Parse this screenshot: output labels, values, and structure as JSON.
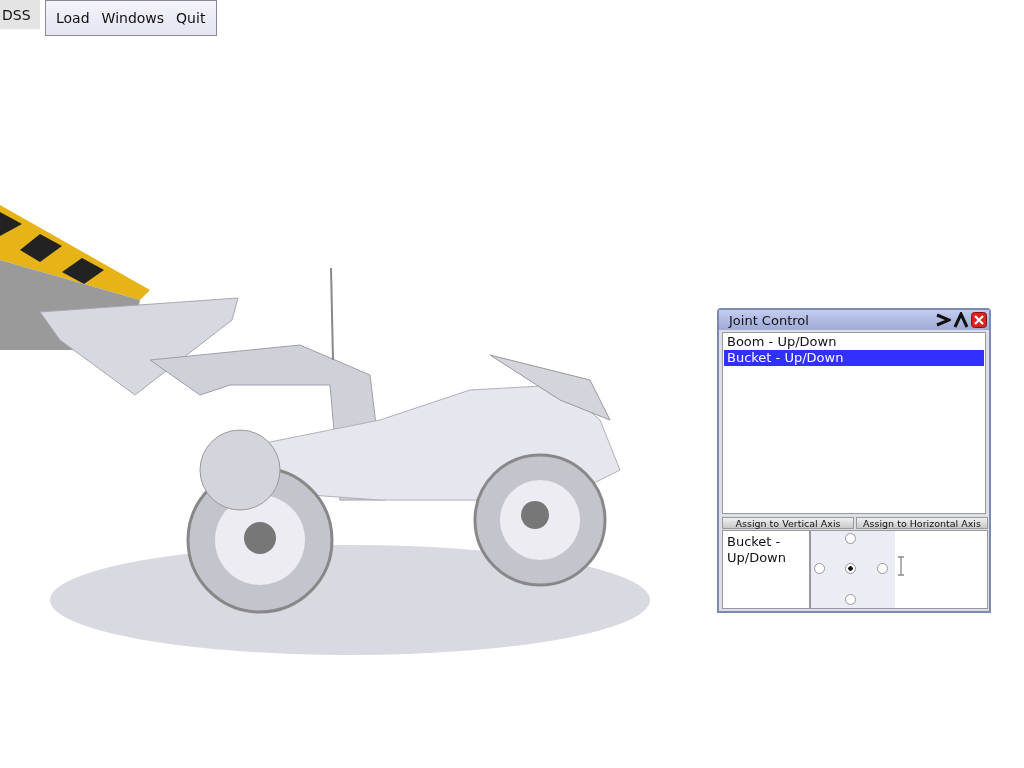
{
  "top_bar": {
    "app_label": "DSS",
    "menu": [
      {
        "label": "Load"
      },
      {
        "label": "Windows"
      },
      {
        "label": "Quit"
      }
    ]
  },
  "joint_control": {
    "title": "Joint Control",
    "joints": [
      {
        "label": "Boom - Up/Down",
        "selected": false
      },
      {
        "label": "Bucket - Up/Down",
        "selected": true
      }
    ],
    "buttons": [
      "Assign to Vertical Axis",
      "Assign to Horizontal Axis"
    ],
    "assigned_joint": "Bucket - Up/Down",
    "pad_positions": [
      {
        "kind": "up",
        "selected": false
      },
      {
        "kind": "left",
        "selected": false
      },
      {
        "kind": "center",
        "selected": true
      },
      {
        "kind": "right",
        "selected": false
      },
      {
        "kind": "down",
        "selected": false
      }
    ]
  }
}
